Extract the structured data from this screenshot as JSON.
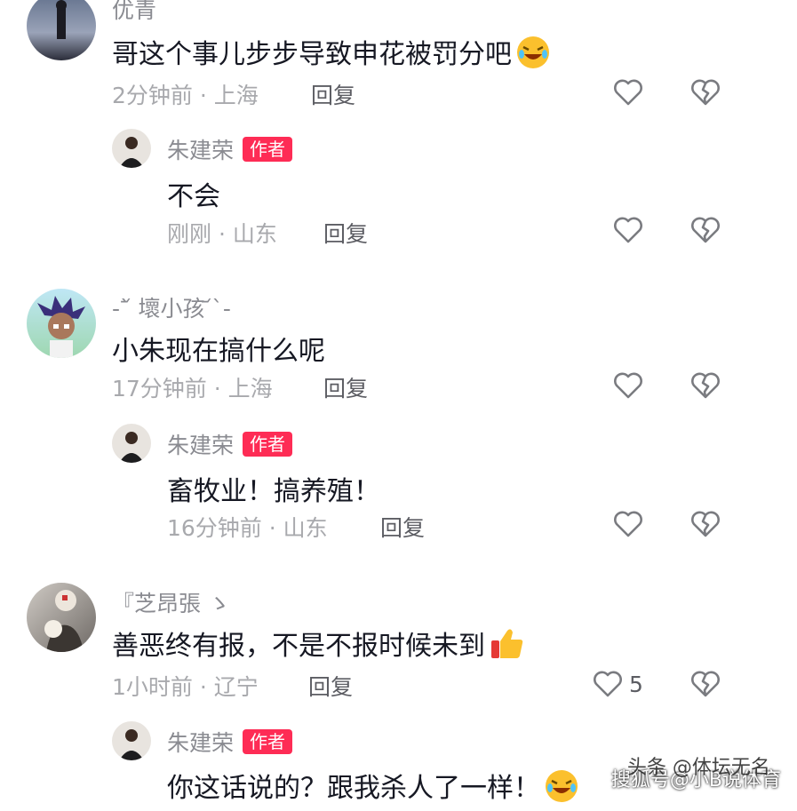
{
  "comments": [
    {
      "username": "优青",
      "text": "哥这个事儿步步导致申花被罚分吧",
      "time": "2分钟前",
      "location": "上海",
      "reply_label": "回复",
      "like_count": "",
      "replies": [
        {
          "username": "朱建荣",
          "badge": "作者",
          "text": "不会",
          "time": "刚刚",
          "location": "山东",
          "reply_label": "回复"
        }
      ]
    },
    {
      "username": "-`᷄ 壞小孩 ᷄`-",
      "text": "小朱现在搞什么呢",
      "time": "17分钟前",
      "location": "上海",
      "reply_label": "回复",
      "like_count": "",
      "replies": [
        {
          "username": "朱建荣",
          "badge": "作者",
          "text": "畜牧业！搞养殖！",
          "time": "16分钟前",
          "location": "山东",
          "reply_label": "回复"
        }
      ]
    },
    {
      "username": "『芝昂張 ゝ",
      "text": "善恶终有报，不是不报时候未到",
      "time": "1小时前",
      "location": "辽宁",
      "reply_label": "回复",
      "like_count": "5",
      "replies": [
        {
          "username": "朱建荣",
          "badge": "作者",
          "text": "你这话说的？跟我杀人了一样！",
          "time": "",
          "location": "",
          "reply_label": ""
        }
      ]
    }
  ],
  "separator": " · ",
  "watermark": {
    "line1": "头条 @体坛无名",
    "line2": "搜狐号@小B说体育"
  },
  "colors": {
    "badge": "#fe2c55",
    "text": "#161823",
    "meta": "#a8a9ad"
  },
  "icons": [
    "heart-outline-icon",
    "broken-heart-icon",
    "grinning-squint-tears-emoji",
    "thumbs-up-emoji"
  ]
}
